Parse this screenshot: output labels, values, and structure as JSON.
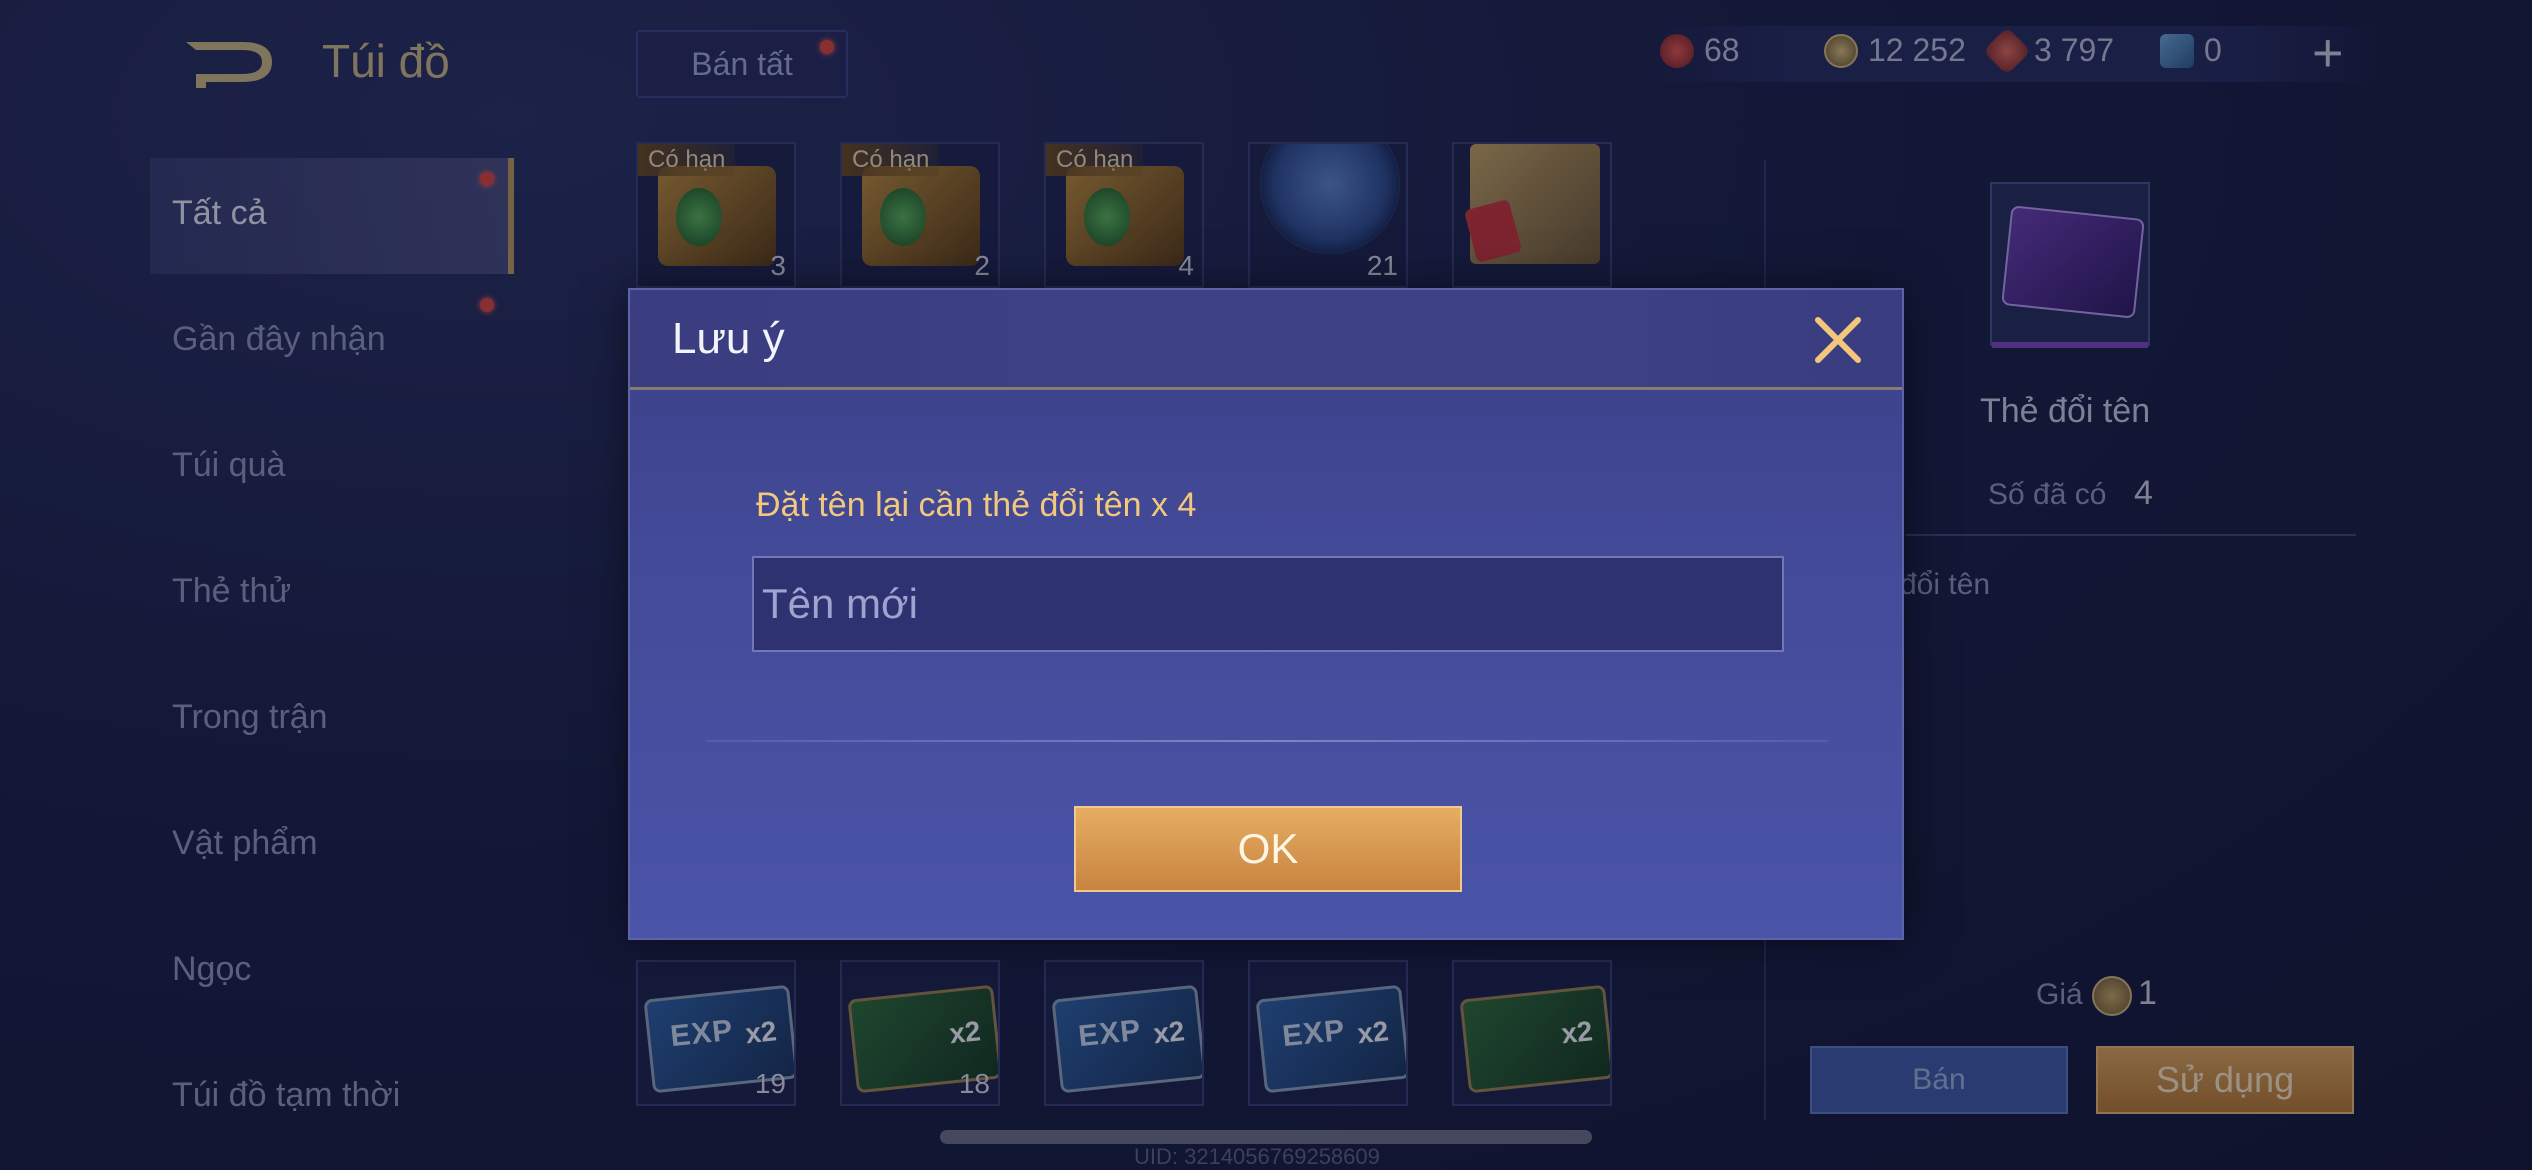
{
  "header": {
    "title": "Túi đồ",
    "sell_all_label": "Bán tất",
    "currencies": [
      {
        "icon": "ruby-icon",
        "value": "68"
      },
      {
        "icon": "gold-coin-icon",
        "value": "12 252"
      },
      {
        "icon": "voucher-icon",
        "value": "3 797"
      },
      {
        "icon": "card-icon",
        "value": "0"
      }
    ]
  },
  "sidebar": {
    "items": [
      {
        "label": "Tất cả"
      },
      {
        "label": "Gần đây nhận"
      },
      {
        "label": "Túi quà"
      },
      {
        "label": "Thẻ thử"
      },
      {
        "label": "Trong trận"
      },
      {
        "label": "Vật phẩm"
      },
      {
        "label": "Ngọc"
      },
      {
        "label": "Túi đồ tạm thời"
      }
    ]
  },
  "grid": {
    "top_row": [
      {
        "tag": "Có hạn",
        "count": "3",
        "icon": "chest-icon"
      },
      {
        "tag": "Có hạn",
        "count": "2",
        "icon": "chest-icon"
      },
      {
        "tag": "Có hạn",
        "count": "4",
        "icon": "chest-icon"
      },
      {
        "tag": "",
        "count": "21",
        "icon": "arcana-coin-icon"
      },
      {
        "tag": "",
        "count": "",
        "icon": "treasure-chest-icon"
      }
    ],
    "bottom_row": [
      {
        "icon": "exp-card-icon",
        "label": "EXP",
        "mult": "x2",
        "count": "19"
      },
      {
        "icon": "gold-card-icon",
        "label": "",
        "mult": "x2",
        "count": "18"
      },
      {
        "icon": "exp-card-icon",
        "label": "EXP",
        "mult": "x2",
        "count": ""
      },
      {
        "icon": "exp-card-icon",
        "label": "EXP",
        "mult": "x2",
        "count": ""
      },
      {
        "icon": "gold-card-icon",
        "label": "",
        "mult": "x2",
        "count": ""
      }
    ]
  },
  "detail": {
    "name": "Thẻ đổi tên",
    "owned_label": "Số đã có",
    "owned_value": "4",
    "description_fragment": "đổi tên",
    "price_label": "Giá",
    "price_value": "1",
    "sell_label": "Bán",
    "use_label": "Sử dụng"
  },
  "footer": {
    "uid": "UID: 3214056769258609"
  },
  "modal": {
    "title": "Lưu ý",
    "hint": "Đặt tên lại cần thẻ đổi tên x 4",
    "input_placeholder": "Tên mới",
    "input_value": "",
    "ok_label": "OK"
  },
  "colors": {
    "accent_gold": "#c9b684",
    "modal_bg": "#434a98",
    "ok_button": "#d89a50",
    "notification_dot": "#d8463f",
    "hint_text": "#f2c87d"
  }
}
